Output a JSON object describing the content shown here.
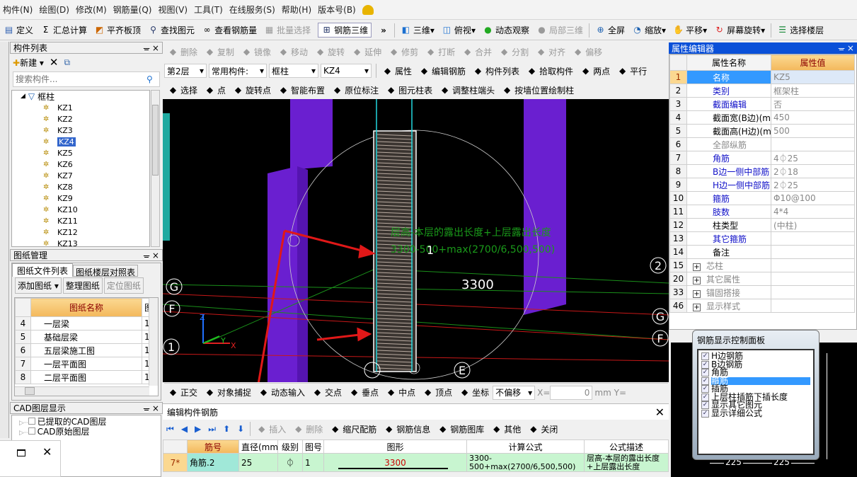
{
  "menu": [
    "构件(N)",
    "绘图(D)",
    "修改(M)",
    "钢筋量(Q)",
    "视图(V)",
    "工具(T)",
    "在线服务(S)",
    "帮助(H)",
    "版本号(B)"
  ],
  "toolbar1": {
    "items": [
      "定义",
      "汇总计算",
      "平齐板顶",
      "查找图元",
      "查看钢筋量",
      "批量选择",
      "钢筋三维"
    ],
    "view_items": [
      "三维",
      "俯视",
      "动态观察",
      "局部三维",
      "全屏",
      "缩放",
      "平移",
      "屏幕旋转",
      "选择楼层"
    ]
  },
  "toolbar_edit": [
    "删除",
    "复制",
    "镜像",
    "移动",
    "旋转",
    "延伸",
    "修剪",
    "打断",
    "合并",
    "分割",
    "对齐",
    "偏移"
  ],
  "selectors": {
    "floor": "第2层",
    "category": "常用构件:",
    "type": "框柱",
    "component": "KZ4"
  },
  "toolbar_prop": [
    "属性",
    "编辑钢筋",
    "构件列表",
    "拾取构件",
    "两点",
    "平行"
  ],
  "toolbar_draw": [
    "选择",
    "点",
    "旋转点",
    "智能布置",
    "原位标注",
    "图元柱表",
    "调整柱端头",
    "按墙位置绘制柱"
  ],
  "component_list": {
    "title": "构件列表",
    "new_label": "新建",
    "search_placeholder": "搜索构件...",
    "root": "框柱",
    "items": [
      "KZ1",
      "KZ2",
      "KZ3",
      "KZ4",
      "KZ5",
      "KZ6",
      "KZ7",
      "KZ8",
      "KZ9",
      "KZ10",
      "KZ11",
      "KZ12",
      "KZ13"
    ],
    "selected": "KZ4"
  },
  "drawing_mgmt": {
    "title": "图纸管理",
    "tabs": [
      "图纸文件列表",
      "图纸楼层对照表"
    ],
    "buttons": [
      "添加图纸",
      "整理图纸",
      "定位图纸"
    ],
    "col_name": "图纸名称",
    "col_2": "图",
    "rows": [
      {
        "n": "4",
        "name": "一层梁",
        "v": "1"
      },
      {
        "n": "5",
        "name": "基础层梁",
        "v": "1"
      },
      {
        "n": "6",
        "name": "五层梁施工图",
        "v": "1"
      },
      {
        "n": "7",
        "name": "一层平面图",
        "v": "1"
      },
      {
        "n": "8",
        "name": "二层平面图",
        "v": "1"
      }
    ]
  },
  "cad_layers": {
    "title": "CAD图层显示",
    "items": [
      "已提取的CAD图层",
      "CAD原始图层"
    ]
  },
  "properties": {
    "title": "属性编辑器",
    "col_name": "属性名称",
    "col_value": "属性值",
    "rows": [
      {
        "n": "1",
        "name": "名称",
        "value": "KZ5",
        "style": "sel"
      },
      {
        "n": "2",
        "name": "类别",
        "value": "框架柱",
        "style": "blue"
      },
      {
        "n": "3",
        "name": "截面编辑",
        "value": "否",
        "style": "blue"
      },
      {
        "n": "4",
        "name": "截面宽(B边)(mm)",
        "value": "450",
        "style": "black"
      },
      {
        "n": "5",
        "name": "截面高(H边)(mm)",
        "value": "500",
        "style": "black"
      },
      {
        "n": "6",
        "name": "全部纵筋",
        "value": "",
        "style": "gray"
      },
      {
        "n": "7",
        "name": "角筋",
        "value": "4⏀25",
        "style": "blue"
      },
      {
        "n": "8",
        "name": "B边一侧中部筋",
        "value": "2⏀18",
        "style": "blue"
      },
      {
        "n": "9",
        "name": "H边一侧中部筋",
        "value": "2⏀25",
        "style": "blue"
      },
      {
        "n": "10",
        "name": "箍筋",
        "value": "Φ10@100",
        "style": "blue"
      },
      {
        "n": "11",
        "name": "肢数",
        "value": "4*4",
        "style": "blue"
      },
      {
        "n": "12",
        "name": "柱类型",
        "value": "(中柱)",
        "style": "black"
      },
      {
        "n": "13",
        "name": "其它箍筋",
        "value": "",
        "style": "blue"
      },
      {
        "n": "14",
        "name": "备注",
        "value": "",
        "style": "black"
      },
      {
        "n": "15",
        "name": "芯柱",
        "value": "",
        "style": "group"
      },
      {
        "n": "20",
        "name": "其它属性",
        "value": "",
        "style": "group"
      },
      {
        "n": "33",
        "name": "锚固搭接",
        "value": "",
        "style": "group"
      },
      {
        "n": "46",
        "name": "显示样式",
        "value": "",
        "style": "group"
      }
    ]
  },
  "rebar_panel": {
    "title": "钢筋显示控制面板",
    "items": [
      "H边钢筋",
      "B边钢筋",
      "角筋",
      "箍筋",
      "插筋",
      "上层柱插筋下插长度",
      "显示其它图元",
      "显示详细公式"
    ],
    "selected": "箍筋"
  },
  "section_dims": [
    "225",
    "225"
  ],
  "canvas": {
    "formula_text": "层高-本层的露出长度+上层露出长度",
    "formula_values": "3300-500+max(2700/6,500,500)",
    "length_label": "3300",
    "axis_labels": [
      "G",
      "F",
      "2",
      "G",
      "F",
      "E",
      "1",
      "1",
      "2"
    ],
    "axes": [
      "Z",
      "Y",
      "X"
    ]
  },
  "snap_toolbar": {
    "items": [
      "正交",
      "对象捕捉",
      "动态输入",
      "交点",
      "垂点",
      "中点",
      "顶点",
      "坐标"
    ],
    "offset": "不偏移",
    "x_label": "X=",
    "x_value": "0",
    "unit": "mm",
    "y_label": "Y="
  },
  "edit_rebar": {
    "title": "编辑构件钢筋",
    "toolbar": [
      "插入",
      "删除",
      "缩尺配筋",
      "钢筋信息",
      "钢筋图库",
      "其他",
      "关闭"
    ],
    "columns": [
      "筋号",
      "直径(mm)",
      "级别",
      "图号",
      "图形",
      "计算公式",
      "公式描述"
    ],
    "row": {
      "n": "7*",
      "name": "角筋.2",
      "dia": "25",
      "grade": "⏀",
      "fig": "1",
      "shape": "3300",
      "formula": "3300-500+max(2700/6,500,500)",
      "desc": "层高-本层的露出长度+上层露出长度"
    }
  },
  "colors": {
    "column": "#6a1fd0",
    "canvas": "#000000",
    "selection": "#3399ff",
    "title_bar": "#0a50d8"
  }
}
